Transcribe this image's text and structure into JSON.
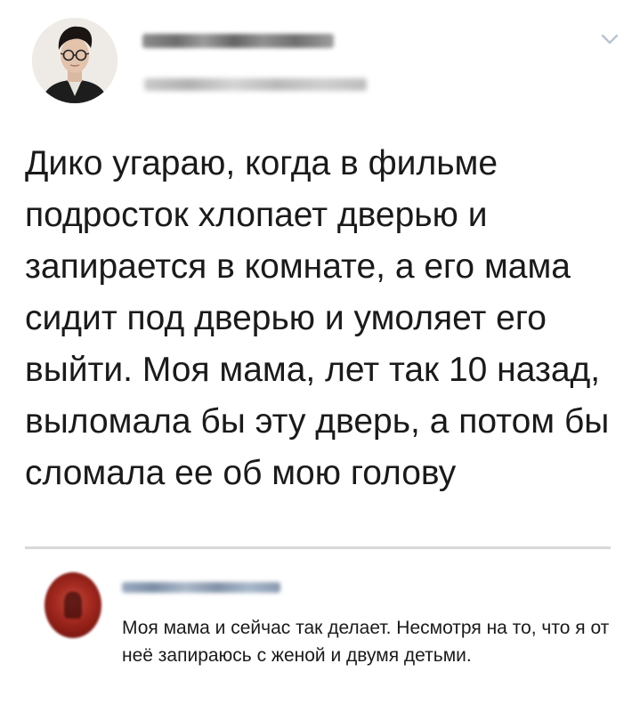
{
  "tweet": {
    "text": "Дико угараю, когда в фильме подросток хлопает дверью и запирается в комнате, а его мама сидит под дверью и умоляет его выйти. Моя мама, лет так 10 назад, выломала бы эту дверь, а потом бы сломала ее об мою голову"
  },
  "comment": {
    "text": "Моя мама и сейчас так делает. Несмотря на то, что я от неё запираюсь с женой и двумя детьми."
  },
  "icons": {
    "menu": "chevron-down-icon"
  },
  "colors": {
    "text": "#1a1a1a",
    "divider": "#d8d8d8",
    "chevron": "#b9c4cf",
    "comment_avatar": "#a3291f"
  }
}
